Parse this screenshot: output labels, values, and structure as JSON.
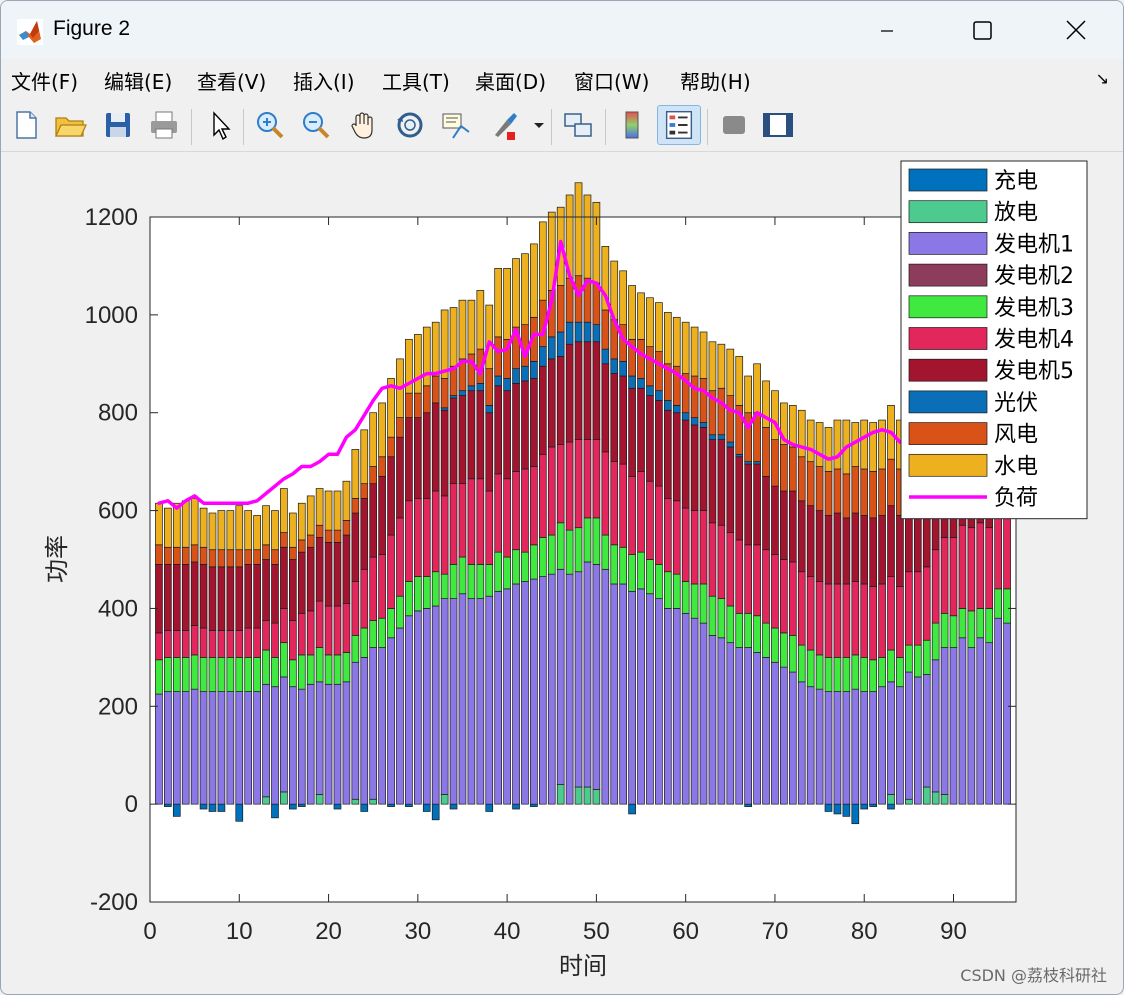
{
  "window": {
    "title": "Figure 2",
    "menu": [
      "文件(F)",
      "编辑(E)",
      "查看(V)",
      "插入(I)",
      "工具(T)",
      "桌面(D)",
      "窗口(W)",
      "帮助(H)"
    ],
    "toolbar_icons": [
      "new-figure-icon",
      "open-file-icon",
      "save-icon",
      "print-icon",
      "pointer-icon",
      "zoom-in-icon",
      "zoom-out-icon",
      "pan-icon",
      "rotate-3d-icon",
      "data-cursor-icon",
      "brush-icon",
      "link-plot-icon",
      "colorbar-icon",
      "legend-icon",
      "hide-plot-tools-icon",
      "show-plot-tools-icon"
    ]
  },
  "watermark": "CSDN @荔枝科研社",
  "chart_data": {
    "type": "bar",
    "stacked": true,
    "xlabel": "时间",
    "ylabel": "功率",
    "xlim": [
      0,
      97
    ],
    "ylim": [
      -200,
      1200
    ],
    "xticks": [
      0,
      10,
      20,
      30,
      40,
      50,
      60,
      70,
      80,
      90
    ],
    "yticks": [
      -200,
      0,
      200,
      400,
      600,
      800,
      1000,
      1200
    ],
    "legend_position": "top-right",
    "x": [
      1,
      2,
      3,
      4,
      5,
      6,
      7,
      8,
      9,
      10,
      11,
      12,
      13,
      14,
      15,
      16,
      17,
      18,
      19,
      20,
      21,
      22,
      23,
      24,
      25,
      26,
      27,
      28,
      29,
      30,
      31,
      32,
      33,
      34,
      35,
      36,
      37,
      38,
      39,
      40,
      41,
      42,
      43,
      44,
      45,
      46,
      47,
      48,
      49,
      50,
      51,
      52,
      53,
      54,
      55,
      56,
      57,
      58,
      59,
      60,
      61,
      62,
      63,
      64,
      65,
      66,
      67,
      68,
      69,
      70,
      71,
      72,
      73,
      74,
      75,
      76,
      77,
      78,
      79,
      80,
      81,
      82,
      83,
      84,
      85,
      86,
      87,
      88,
      89,
      90,
      91,
      92,
      93,
      94,
      95,
      96
    ],
    "series": [
      {
        "name": "充电",
        "color": "#0072BD",
        "values": [
          0,
          -5,
          -25,
          0,
          0,
          -10,
          -15,
          -15,
          0,
          -35,
          0,
          0,
          0,
          -28,
          0,
          -10,
          -5,
          0,
          0,
          0,
          -10,
          0,
          0,
          -15,
          0,
          0,
          -5,
          0,
          -5,
          0,
          -15,
          -32,
          0,
          -10,
          0,
          0,
          0,
          -15,
          0,
          0,
          -10,
          0,
          -5,
          0,
          0,
          0,
          0,
          0,
          0,
          0,
          0,
          0,
          0,
          -20,
          0,
          0,
          0,
          0,
          0,
          0,
          0,
          0,
          0,
          0,
          0,
          0,
          -5,
          0,
          0,
          0,
          0,
          0,
          0,
          0,
          0,
          -15,
          -20,
          -25,
          -40,
          -10,
          -5,
          0,
          -10,
          0,
          0,
          0,
          0,
          0,
          0,
          0,
          0,
          0,
          0,
          0,
          0,
          0
        ]
      },
      {
        "name": "放电",
        "color": "#4DCB8F",
        "values": [
          0,
          0,
          0,
          0,
          0,
          0,
          0,
          0,
          0,
          0,
          0,
          0,
          15,
          0,
          25,
          0,
          0,
          0,
          20,
          0,
          0,
          0,
          10,
          0,
          10,
          0,
          0,
          0,
          0,
          0,
          0,
          0,
          20,
          0,
          0,
          0,
          0,
          0,
          0,
          0,
          0,
          0,
          0,
          0,
          0,
          40,
          0,
          35,
          35,
          30,
          0,
          0,
          0,
          0,
          0,
          0,
          0,
          0,
          0,
          0,
          0,
          0,
          0,
          0,
          0,
          0,
          0,
          0,
          0,
          0,
          0,
          0,
          0,
          0,
          0,
          0,
          0,
          0,
          0,
          0,
          0,
          0,
          20,
          0,
          10,
          0,
          35,
          25,
          20,
          0,
          0,
          0,
          0,
          0,
          0,
          0
        ]
      },
      {
        "name": "发电机1",
        "color": "#8B78E6",
        "values": [
          225,
          230,
          230,
          230,
          235,
          230,
          230,
          230,
          230,
          230,
          230,
          230,
          230,
          240,
          235,
          240,
          235,
          245,
          230,
          245,
          245,
          250,
          280,
          300,
          310,
          320,
          340,
          360,
          385,
          395,
          400,
          405,
          400,
          420,
          430,
          420,
          420,
          425,
          435,
          440,
          450,
          455,
          460,
          465,
          470,
          440,
          470,
          440,
          460,
          460,
          480,
          450,
          450,
          435,
          440,
          430,
          420,
          400,
          400,
          390,
          380,
          370,
          345,
          340,
          330,
          320,
          320,
          310,
          300,
          290,
          280,
          270,
          250,
          240,
          235,
          230,
          230,
          230,
          235,
          230,
          230,
          240,
          230,
          240,
          260,
          260,
          230,
          270,
          300,
          320,
          340,
          320,
          340,
          330,
          380,
          370
        ]
      },
      {
        "name": "发电机2",
        "color": "#8E3C5C",
        "values": [
          0,
          0,
          0,
          0,
          0,
          0,
          0,
          0,
          0,
          0,
          0,
          0,
          0,
          0,
          0,
          0,
          0,
          0,
          0,
          0,
          0,
          0,
          0,
          0,
          0,
          0,
          0,
          0,
          0,
          0,
          0,
          0,
          0,
          0,
          0,
          0,
          0,
          0,
          0,
          0,
          0,
          0,
          0,
          0,
          0,
          0,
          0,
          0,
          0,
          0,
          0,
          0,
          0,
          0,
          0,
          0,
          0,
          0,
          0,
          0,
          0,
          0,
          0,
          0,
          0,
          0,
          0,
          0,
          0,
          0,
          0,
          0,
          0,
          0,
          0,
          0,
          0,
          0,
          0,
          0,
          0,
          0,
          0,
          0,
          0,
          0,
          0,
          0,
          0,
          0,
          0,
          0,
          0,
          0,
          0,
          0
        ]
      },
      {
        "name": "发电机3",
        "color": "#3FE93F",
        "values": [
          70,
          70,
          70,
          70,
          70,
          70,
          70,
          70,
          70,
          70,
          70,
          70,
          70,
          60,
          70,
          55,
          70,
          60,
          70,
          60,
          60,
          60,
          55,
          60,
          55,
          60,
          60,
          65,
          70,
          70,
          65,
          70,
          50,
          70,
          75,
          70,
          70,
          65,
          80,
          65,
          70,
          60,
          70,
          80,
          80,
          95,
          90,
          90,
          90,
          95,
          70,
          80,
          75,
          75,
          75,
          70,
          70,
          75,
          70,
          65,
          70,
          80,
          80,
          80,
          75,
          70,
          70,
          75,
          70,
          70,
          70,
          75,
          75,
          75,
          70,
          70,
          70,
          70,
          70,
          70,
          65,
          60,
          65,
          60,
          55,
          65,
          70,
          75,
          70,
          65,
          60,
          75,
          60,
          70,
          60,
          70
        ]
      },
      {
        "name": "发电机4",
        "color": "#E3265C",
        "values": [
          55,
          55,
          55,
          55,
          60,
          60,
          55,
          55,
          55,
          55,
          60,
          60,
          60,
          70,
          70,
          80,
          85,
          90,
          95,
          100,
          100,
          100,
          110,
          120,
          130,
          130,
          150,
          160,
          165,
          160,
          160,
          165,
          160,
          165,
          150,
          175,
          175,
          150,
          160,
          160,
          160,
          170,
          160,
          170,
          180,
          160,
          180,
          180,
          160,
          160,
          170,
          170,
          170,
          160,
          165,
          160,
          160,
          150,
          150,
          150,
          150,
          150,
          150,
          150,
          150,
          150,
          140,
          145,
          150,
          150,
          150,
          150,
          150,
          150,
          150,
          150,
          150,
          150,
          150,
          150,
          150,
          150,
          150,
          145,
          150,
          150,
          150,
          150,
          155,
          160,
          170,
          170,
          175,
          165,
          165,
          170
        ]
      },
      {
        "name": "发电机5",
        "color": "#A3142E",
        "values": [
          140,
          135,
          135,
          135,
          130,
          130,
          130,
          130,
          130,
          130,
          130,
          130,
          125,
          120,
          125,
          125,
          125,
          130,
          130,
          130,
          130,
          140,
          140,
          145,
          150,
          160,
          160,
          165,
          170,
          165,
          175,
          180,
          175,
          175,
          180,
          180,
          180,
          160,
          180,
          180,
          180,
          180,
          180,
          180,
          180,
          180,
          200,
          200,
          200,
          200,
          180,
          180,
          180,
          180,
          170,
          175,
          175,
          180,
          180,
          180,
          175,
          170,
          170,
          175,
          175,
          170,
          165,
          165,
          150,
          140,
          140,
          145,
          145,
          145,
          145,
          140,
          145,
          135,
          140,
          140,
          140,
          140,
          145,
          145,
          145,
          150,
          155,
          165,
          150,
          150,
          140,
          130,
          120,
          125,
          120,
          130
        ]
      },
      {
        "name": "光伏",
        "color": "#0B6FB8",
        "values": [
          0,
          0,
          0,
          0,
          0,
          0,
          0,
          0,
          0,
          0,
          0,
          0,
          0,
          0,
          0,
          0,
          0,
          0,
          0,
          0,
          0,
          0,
          0,
          0,
          0,
          0,
          0,
          0,
          0,
          0,
          0,
          0,
          5,
          5,
          10,
          10,
          15,
          15,
          20,
          25,
          30,
          30,
          35,
          40,
          45,
          50,
          45,
          40,
          40,
          35,
          30,
          30,
          30,
          25,
          20,
          20,
          20,
          20,
          15,
          15,
          15,
          10,
          10,
          10,
          10,
          5,
          5,
          5,
          0,
          0,
          0,
          0,
          0,
          0,
          0,
          0,
          0,
          0,
          0,
          0,
          0,
          0,
          0,
          0,
          0,
          0,
          0,
          0,
          0,
          0,
          0,
          0,
          0,
          0,
          0,
          0
        ]
      },
      {
        "name": "风电",
        "color": "#D95319",
        "values": [
          40,
          35,
          35,
          35,
          35,
          35,
          35,
          35,
          35,
          35,
          30,
          30,
          30,
          30,
          30,
          25,
          25,
          25,
          25,
          25,
          25,
          30,
          30,
          30,
          35,
          40,
          40,
          40,
          50,
          50,
          55,
          55,
          60,
          60,
          65,
          65,
          70,
          75,
          80,
          80,
          85,
          85,
          90,
          95,
          95,
          95,
          90,
          95,
          90,
          85,
          80,
          80,
          75,
          75,
          80,
          80,
          80,
          75,
          80,
          80,
          85,
          90,
          90,
          95,
          95,
          100,
          100,
          100,
          100,
          95,
          95,
          90,
          90,
          90,
          90,
          90,
          90,
          90,
          95,
          95,
          95,
          95,
          95,
          95,
          95,
          95,
          95,
          95,
          90,
          85,
          85,
          80,
          80,
          75,
          70,
          60
        ]
      },
      {
        "name": "水电",
        "color": "#EDB120",
        "values": [
          85,
          80,
          90,
          95,
          95,
          80,
          75,
          80,
          80,
          90,
          80,
          70,
          80,
          80,
          90,
          70,
          75,
          80,
          75,
          80,
          80,
          80,
          100,
          110,
          110,
          110,
          120,
          120,
          110,
          120,
          120,
          110,
          140,
          120,
          120,
          110,
          120,
          130,
          140,
          145,
          140,
          145,
          150,
          160,
          160,
          160,
          170,
          190,
          170,
          165,
          130,
          120,
          110,
          110,
          95,
          100,
          100,
          105,
          100,
          105,
          100,
          95,
          100,
          90,
          95,
          100,
          75,
          100,
          95,
          100,
          85,
          85,
          95,
          85,
          90,
          90,
          100,
          110,
          90,
          100,
          100,
          100,
          110,
          100,
          85,
          90,
          100,
          85,
          80,
          80,
          60,
          90,
          75,
          80,
          80,
          100
        ]
      },
      {
        "name": "负荷",
        "color": "#FF00FF",
        "type": "line",
        "values": [
          615,
          620,
          605,
          620,
          630,
          615,
          615,
          615,
          615,
          615,
          615,
          620,
          635,
          650,
          665,
          675,
          690,
          690,
          700,
          715,
          715,
          750,
          765,
          795,
          825,
          850,
          855,
          850,
          860,
          870,
          880,
          880,
          885,
          890,
          905,
          905,
          880,
          945,
          925,
          930,
          970,
          915,
          960,
          960,
          1030,
          1150,
          1080,
          1040,
          1070,
          1065,
          1040,
          990,
          950,
          935,
          920,
          910,
          900,
          890,
          880,
          865,
          850,
          845,
          830,
          820,
          805,
          800,
          770,
          800,
          790,
          780,
          745,
          735,
          730,
          725,
          715,
          705,
          710,
          730,
          740,
          750,
          760,
          765,
          760,
          740,
          740,
          745,
          750,
          740,
          745,
          750,
          740,
          735,
          735,
          725,
          725,
          720
        ]
      }
    ]
  }
}
